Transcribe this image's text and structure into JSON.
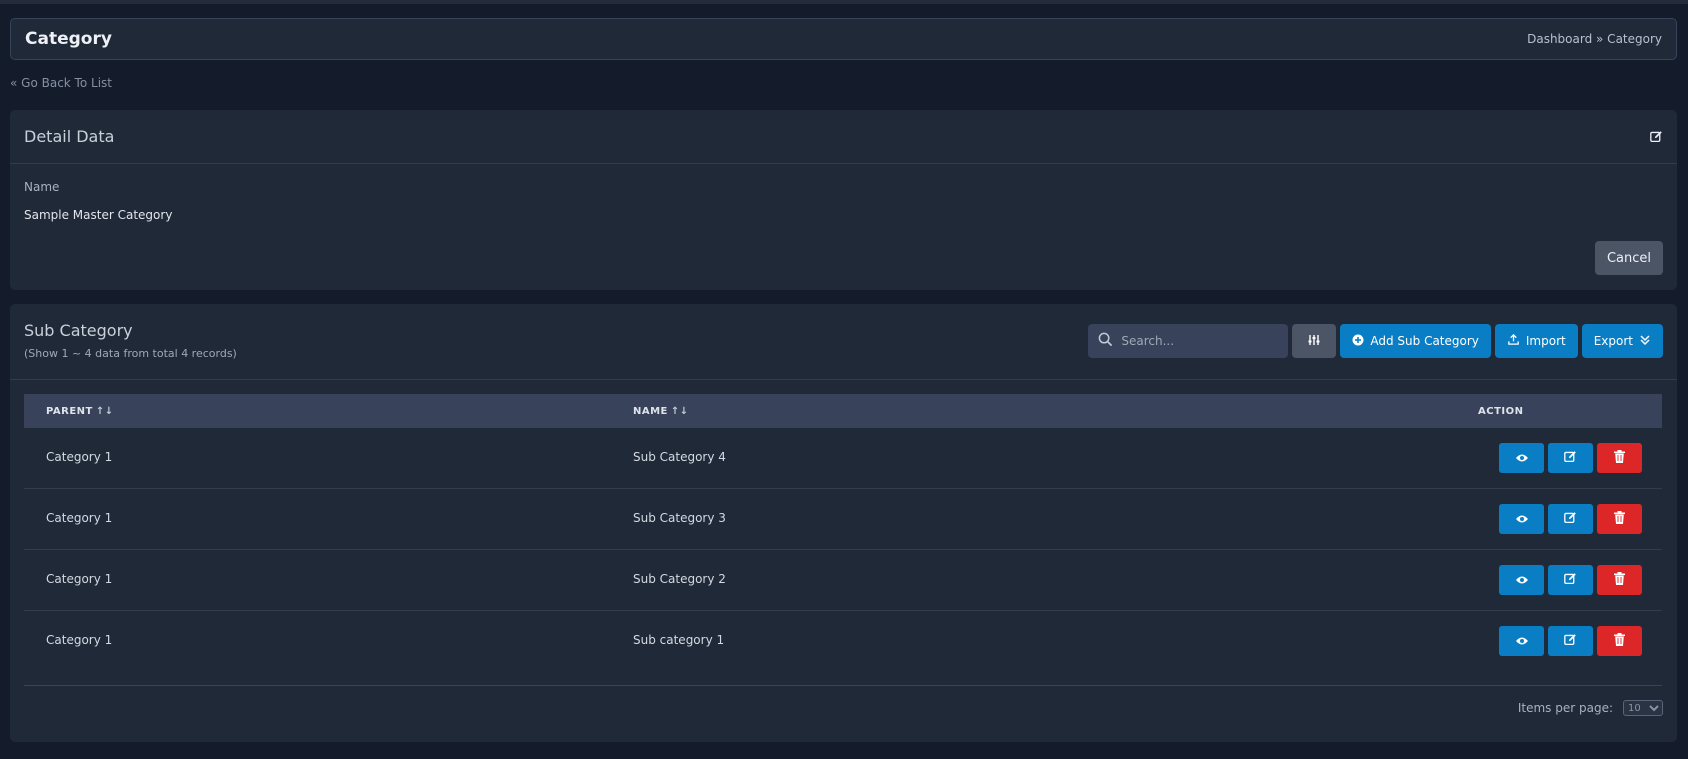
{
  "header": {
    "title": "Category",
    "breadcrumb": "Dashboard » Category"
  },
  "back_link": "« Go Back To List",
  "detail": {
    "title": "Detail Data",
    "field_label": "Name",
    "field_value": "Sample Master Category",
    "cancel_label": "Cancel"
  },
  "sub_category": {
    "title": "Sub Category",
    "meta": "(Show 1 ~ 4 data from total 4 records)",
    "search_placeholder": "Search...",
    "add_label": "Add Sub Category",
    "import_label": "Import",
    "export_label": "Export",
    "columns": {
      "parent": "PARENT",
      "name": "NAME",
      "action": "ACTION"
    },
    "sort_glyph": "↑↓",
    "rows": [
      {
        "parent": "Category 1",
        "name": "Sub Category 4"
      },
      {
        "parent": "Category 1",
        "name": "Sub Category 3"
      },
      {
        "parent": "Category 1",
        "name": "Sub Category 2"
      },
      {
        "parent": "Category 1",
        "name": "Sub category 1"
      }
    ],
    "items_per_page_label": "Items per page:",
    "items_per_page_value": "10"
  },
  "colors": {
    "background": "#141b2b",
    "card": "#202938",
    "primary": "#0a7ec4",
    "danger": "#dc2628",
    "secondary": "#4b5566"
  },
  "icons": {
    "edit": "edit-icon",
    "search": "search-icon",
    "filter": "sliders-icon",
    "add": "plus-circle-icon",
    "import": "upload-icon",
    "export": "chevrons-down-icon",
    "view": "eye-icon",
    "delete": "trash-icon"
  }
}
